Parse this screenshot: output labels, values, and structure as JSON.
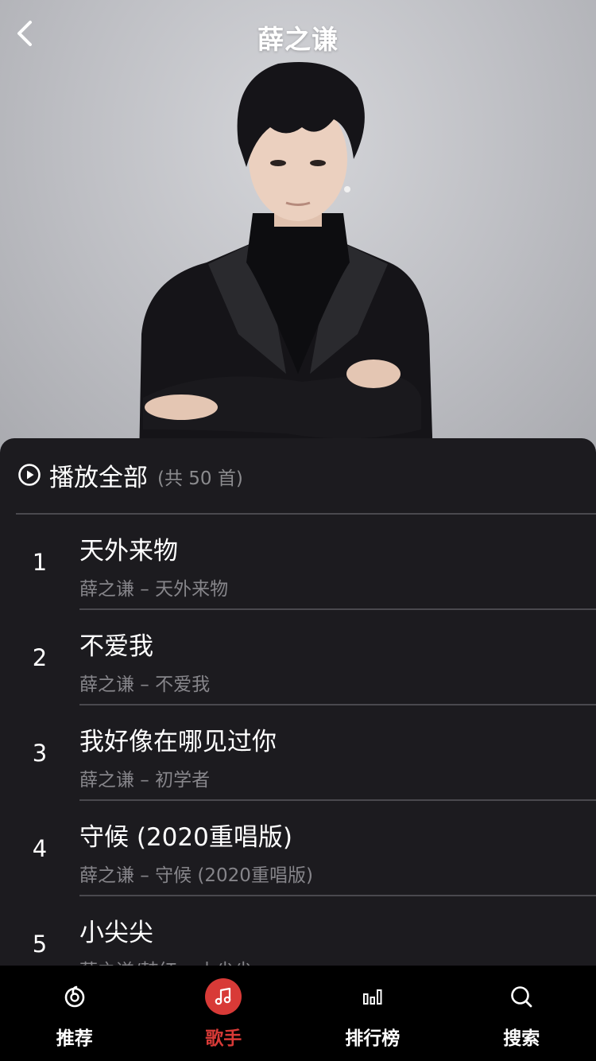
{
  "header": {
    "title": "薛之谦"
  },
  "play_all": {
    "label": "播放全部",
    "count": "(共 50 首)"
  },
  "songs": [
    {
      "index": "1",
      "title": "天外来物",
      "subtitle": "薛之谦 – 天外来物"
    },
    {
      "index": "2",
      "title": "不爱我",
      "subtitle": "薛之谦 – 不爱我"
    },
    {
      "index": "3",
      "title": "我好像在哪见过你",
      "subtitle": "薛之谦 – 初学者"
    },
    {
      "index": "4",
      "title": "守候 (2020重唱版)",
      "subtitle": "薛之谦 – 守候 (2020重唱版)"
    },
    {
      "index": "5",
      "title": "小尖尖",
      "subtitle": "薛之谦/韩红 – 小尖尖"
    }
  ],
  "tabs": [
    {
      "label": "推荐",
      "icon": "netease-logo-icon",
      "active": false
    },
    {
      "label": "歌手",
      "icon": "music-note-icon",
      "active": true
    },
    {
      "label": "排行榜",
      "icon": "bar-chart-icon",
      "active": false
    },
    {
      "label": "搜索",
      "icon": "search-icon",
      "active": false
    }
  ],
  "colors": {
    "accent": "#d83a37",
    "panel_bg": "#1c1b1f",
    "tabbar_bg": "#000000",
    "secondary_text": "#86858a"
  }
}
